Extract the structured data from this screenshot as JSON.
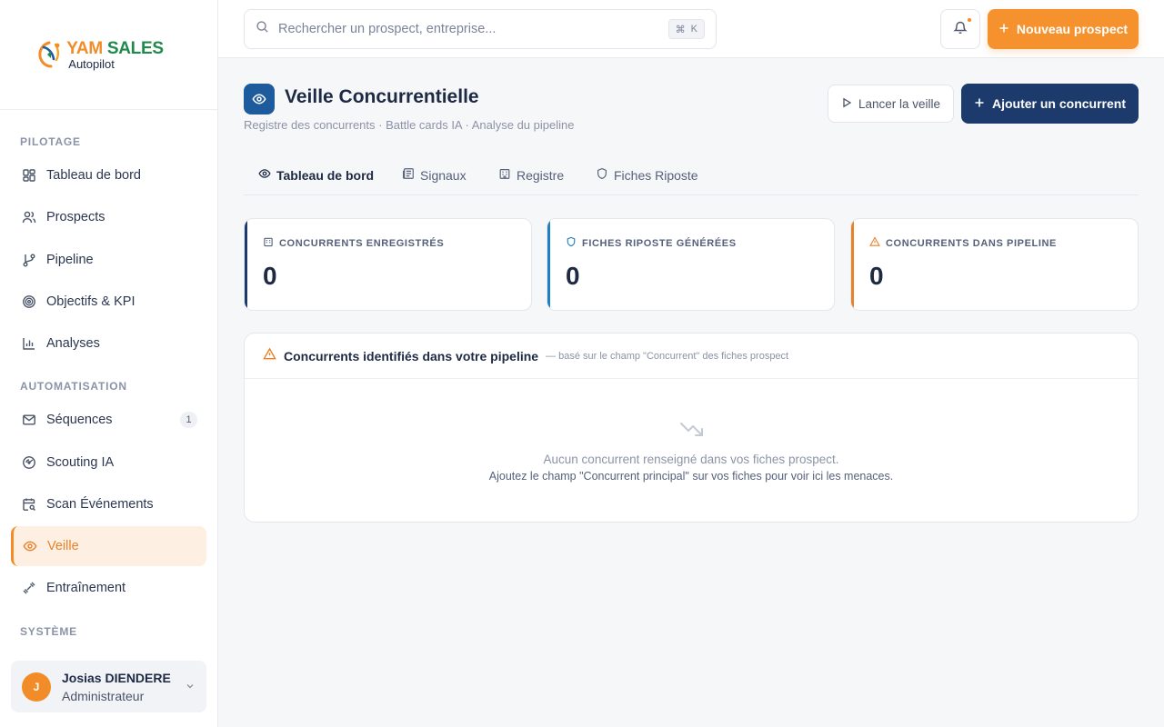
{
  "brand": {
    "name_part1": "YAM",
    "name_part2": "SALES",
    "tagline": "Autopilot"
  },
  "sidebar": {
    "sections": [
      {
        "title": "PILOTAGE"
      },
      {
        "title": "AUTOMATISATION"
      },
      {
        "title": "SYSTÈME"
      }
    ],
    "items": [
      {
        "label": "Tableau de bord",
        "icon": "layout-dashboard-icon"
      },
      {
        "label": "Prospects",
        "icon": "users-icon"
      },
      {
        "label": "Pipeline",
        "icon": "git-branch-icon"
      },
      {
        "label": "Objectifs & KPI",
        "icon": "target-icon"
      },
      {
        "label": "Analyses",
        "icon": "bar-chart-icon"
      },
      {
        "label": "Séquences",
        "icon": "mail-icon",
        "badge": "1"
      },
      {
        "label": "Scouting IA",
        "icon": "radar-icon"
      },
      {
        "label": "Scan Événements",
        "icon": "calendar-search-icon"
      },
      {
        "label": "Veille",
        "icon": "eye-icon",
        "active": true
      },
      {
        "label": "Entraînement",
        "icon": "dumbbell-icon"
      }
    ],
    "user": {
      "initial": "J",
      "name": "Josias DIENDERE",
      "role": "Administrateur"
    }
  },
  "topbar": {
    "search_placeholder": "Rechercher un prospect, entreprise...",
    "shortcut_key": "K",
    "new_button": "Nouveau prospect"
  },
  "page": {
    "title": "Veille Concurrentielle",
    "subtitle": "Registre des concurrents · Battle cards IA · Analyse du pipeline",
    "launch_button": "Lancer la veille",
    "add_button": "Ajouter un concurrent",
    "tabs": [
      {
        "label": "Tableau de bord",
        "active": true
      },
      {
        "label": "Signaux"
      },
      {
        "label": "Registre"
      },
      {
        "label": "Fiches Riposte"
      }
    ],
    "kpis": [
      {
        "label": "CONCURRENTS ENREGISTRÉS",
        "value": "0",
        "color": "#1c3a6b"
      },
      {
        "label": "FICHES RIPOSTE GÉNÉRÉES",
        "value": "0",
        "color": "#1e7fc2"
      },
      {
        "label": "CONCURRENTS DANS PIPELINE",
        "value": "0",
        "color": "#e8822a"
      }
    ],
    "panel": {
      "title": "Concurrents identifiés dans votre pipeline",
      "note": "— basé sur le champ \"Concurrent\" des fiches prospect",
      "empty_line1": "Aucun concurrent renseigné dans vos fiches prospect.",
      "empty_line2": "Ajoutez le champ \"Concurrent principal\" sur vos fiches pour voir ici les menaces."
    }
  },
  "colors": {
    "accent": "#f28c28",
    "navy": "#1c3a6b",
    "brand_green": "#1f8a4c"
  }
}
